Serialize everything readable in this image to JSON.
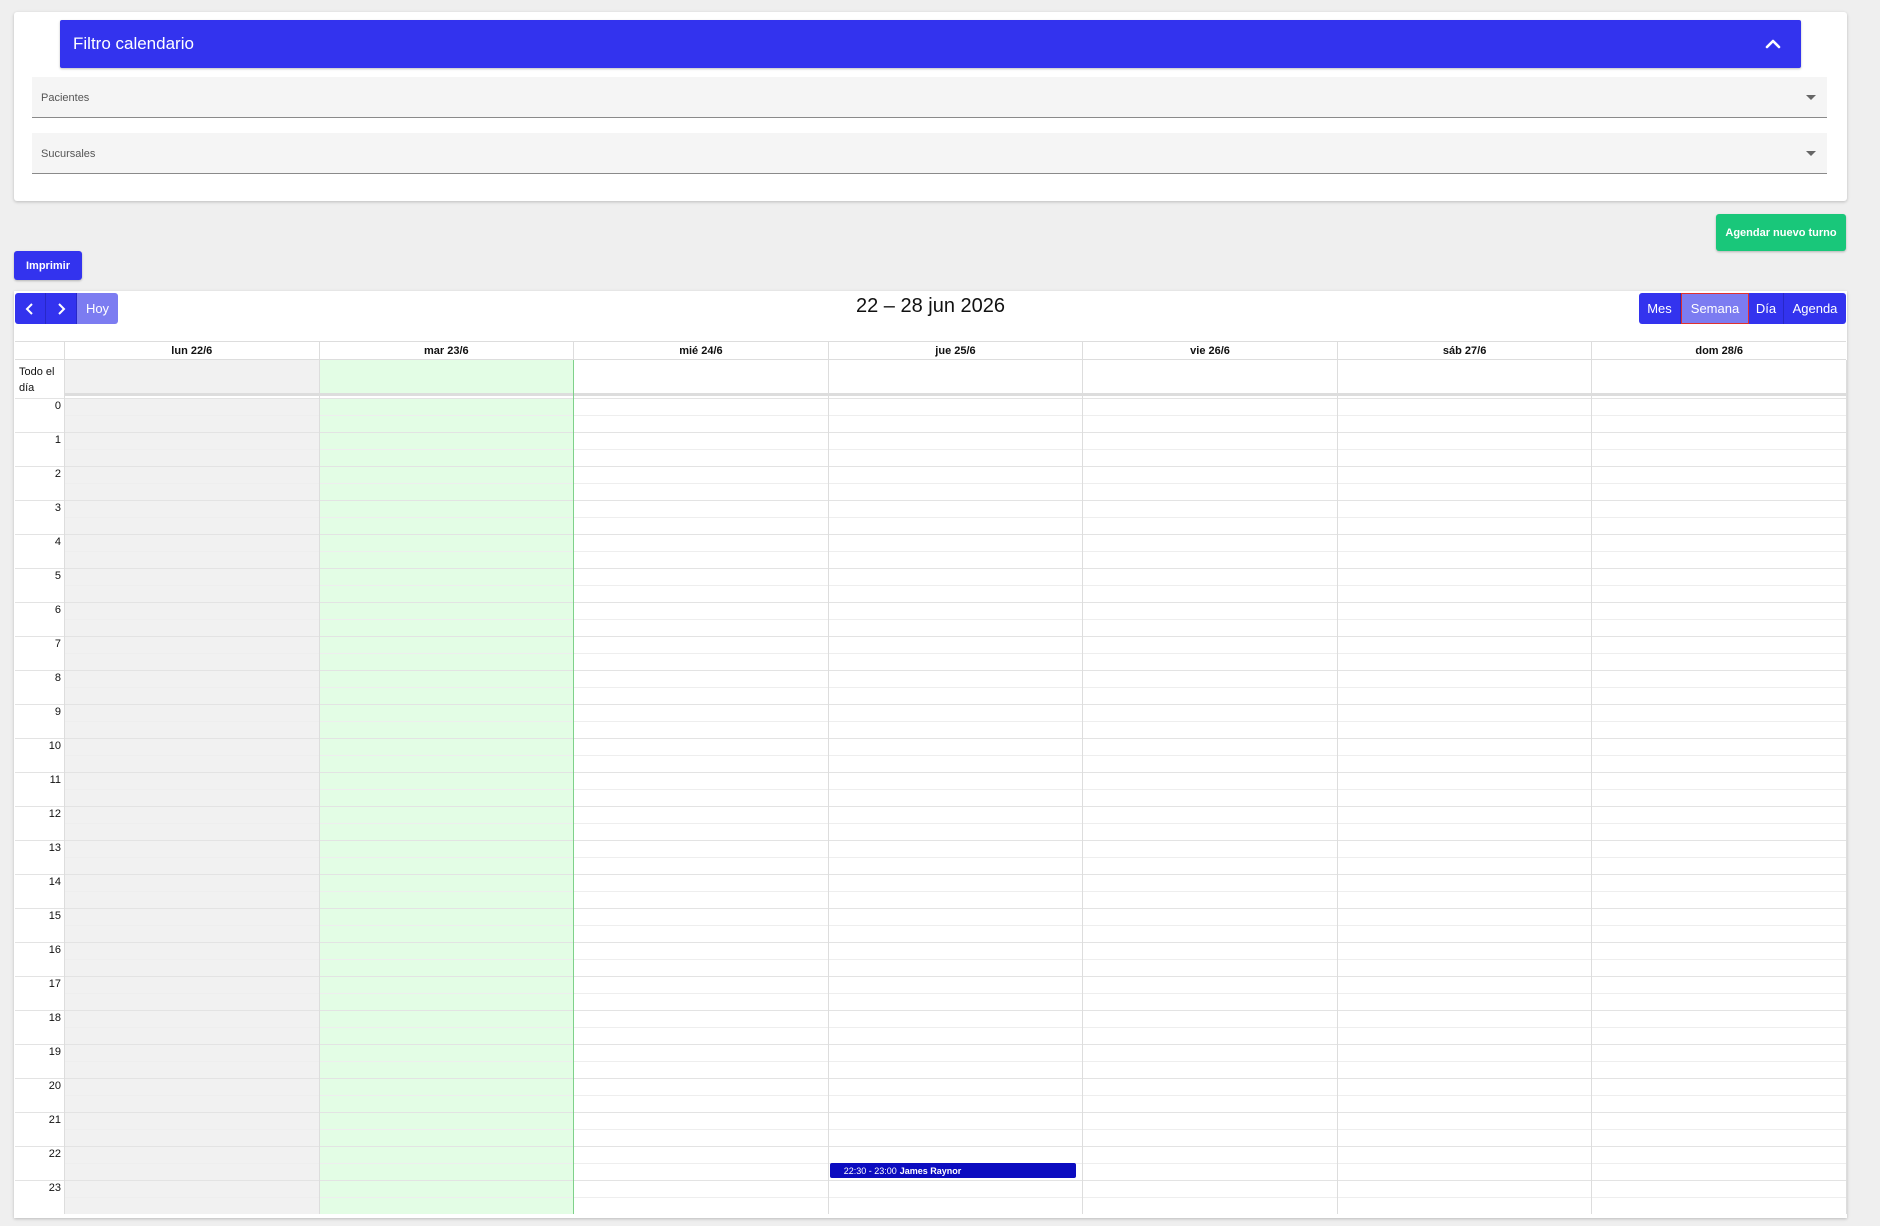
{
  "filter": {
    "title": "Filtro calendario",
    "fields": [
      {
        "label": "Pacientes"
      },
      {
        "label": "Sucursales"
      }
    ]
  },
  "actions": {
    "new_appointment": "Agendar nuevo turno",
    "print": "Imprimir"
  },
  "calendar": {
    "range_title": "22 – 28 jun 2026",
    "nav": {
      "today": "Hoy"
    },
    "views": [
      {
        "label": "Mes",
        "active": false
      },
      {
        "label": "Semana",
        "active": true
      },
      {
        "label": "Día",
        "active": false
      },
      {
        "label": "Agenda",
        "active": false
      }
    ],
    "days": [
      {
        "label": "lun 22/6",
        "state": "past"
      },
      {
        "label": "mar 23/6",
        "state": "today"
      },
      {
        "label": "mié 24/6",
        "state": "future"
      },
      {
        "label": "jue 25/6",
        "state": "future"
      },
      {
        "label": "vie 26/6",
        "state": "future"
      },
      {
        "label": "sáb 27/6",
        "state": "future"
      },
      {
        "label": "dom 28/6",
        "state": "future"
      }
    ],
    "all_day_label": "Todo el día",
    "hours": [
      "0",
      "1",
      "2",
      "3",
      "4",
      "5",
      "6",
      "7",
      "8",
      "9",
      "10",
      "11",
      "12",
      "13",
      "14",
      "15",
      "16",
      "17",
      "18",
      "19",
      "20",
      "21",
      "22",
      "23"
    ],
    "events": [
      {
        "day_index": 3,
        "start": "22:30",
        "end": "23:00",
        "time_text": "22:30 - 23:00",
        "title": "James Raynor"
      }
    ]
  },
  "colors": {
    "primary": "#3333ee",
    "primary_active": "#7c7cf1",
    "success": "#19c77a",
    "today_bg": "#e3fde5",
    "past_bg": "#f1f1f1",
    "event_bg": "#0c0cc0"
  }
}
